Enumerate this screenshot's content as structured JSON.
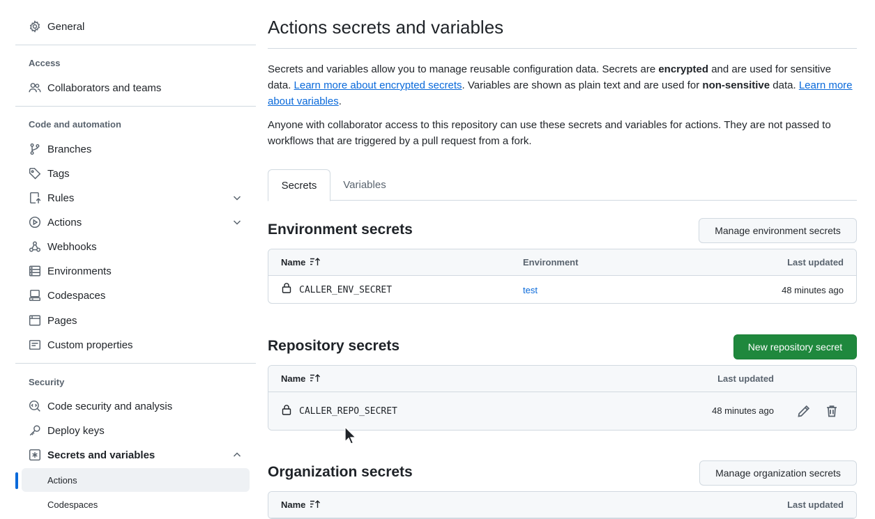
{
  "sidebar": {
    "general": "General",
    "access_heading": "Access",
    "collaborators": "Collaborators and teams",
    "code_heading": "Code and automation",
    "branches": "Branches",
    "tags": "Tags",
    "rules": "Rules",
    "actions": "Actions",
    "webhooks": "Webhooks",
    "environments": "Environments",
    "codespaces": "Codespaces",
    "pages": "Pages",
    "custom_properties": "Custom properties",
    "security_heading": "Security",
    "code_security": "Code security and analysis",
    "deploy_keys": "Deploy keys",
    "secrets_variables": "Secrets and variables",
    "sub_actions": "Actions",
    "sub_codespaces": "Codespaces"
  },
  "main": {
    "title": "Actions secrets and variables",
    "intro_1": "Secrets and variables allow you to manage reusable configuration data. Secrets are ",
    "intro_encrypted": "encrypted",
    "intro_2": " and are used for sensitive data. ",
    "intro_link1": "Learn more about encrypted secrets",
    "intro_3": ". Variables are shown as plain text and are used for ",
    "intro_nonsensitive": "non-sensitive",
    "intro_4": " data. ",
    "intro_link2": "Learn more about variables",
    "intro_5": ".",
    "access_note": "Anyone with collaborator access to this repository can use these secrets and variables for actions. They are not passed to workflows that are triggered by a pull request from a fork.",
    "tabs": [
      {
        "label": "Secrets",
        "selected": true
      },
      {
        "label": "Variables",
        "selected": false
      }
    ]
  },
  "env_secrets": {
    "heading": "Environment secrets",
    "button": "Manage environment secrets",
    "col_name": "Name",
    "col_env": "Environment",
    "col_updated": "Last updated",
    "rows": [
      {
        "name": "CALLER_ENV_SECRET",
        "environment": "test",
        "updated": "48 minutes ago"
      }
    ]
  },
  "repo_secrets": {
    "heading": "Repository secrets",
    "button": "New repository secret",
    "col_name": "Name",
    "col_updated": "Last updated",
    "rows": [
      {
        "name": "CALLER_REPO_SECRET",
        "updated": "48 minutes ago"
      }
    ]
  },
  "org_secrets": {
    "heading": "Organization secrets",
    "button": "Manage organization secrets",
    "col_name": "Name",
    "col_updated": "Last updated"
  },
  "colors": {
    "accent": "#0969da",
    "primary_button": "#1f883d",
    "border": "#d1d9e0",
    "muted_text": "#59636e"
  }
}
